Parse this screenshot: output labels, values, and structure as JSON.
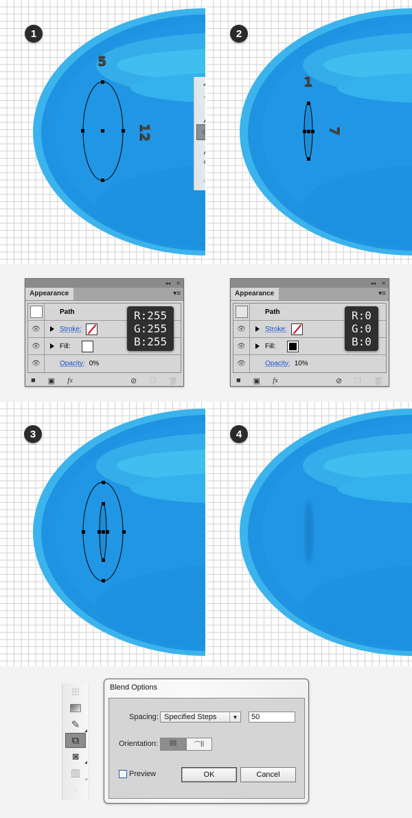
{
  "steps": [
    {
      "number": "1",
      "width_label": "5",
      "height_label": "12"
    },
    {
      "number": "2",
      "width_label": "1",
      "height_label": "7"
    },
    {
      "number": "3"
    },
    {
      "number": "4"
    }
  ],
  "colors": {
    "shape_blue": "#1f93e2",
    "shape_light": "#3bb6ee",
    "grid_line": "#d2d2d2",
    "badge": "#2b2b2b"
  },
  "toolbox_top": {
    "tools": [
      {
        "icon": "pen-icon",
        "glyph": "✒"
      },
      {
        "icon": "type-icon",
        "glyph": "T"
      },
      {
        "icon": "line-icon",
        "glyph": "╱"
      },
      {
        "icon": "ellipse-icon",
        "glyph": "⬭",
        "active": true
      },
      {
        "icon": "paintbrush-icon",
        "glyph": "🖌"
      },
      {
        "icon": "pencil-icon",
        "glyph": "✎"
      },
      {
        "icon": "eraser-icon",
        "glyph": "⌫"
      }
    ]
  },
  "appearance_panels": [
    {
      "tab": "Appearance",
      "path_label": "Path",
      "stroke_label": "Stroke:",
      "fill_label": "Fill:",
      "opacity_label": "Opacity:",
      "opacity_value": "0%",
      "fill_color": "#ffffff",
      "rgb": {
        "r": "R:255",
        "g": "G:255",
        "b": "B:255"
      }
    },
    {
      "tab": "Appearance",
      "path_label": "Path",
      "stroke_label": "Stroke:",
      "fill_label": "Fill:",
      "opacity_label": "Opacity:",
      "opacity_value": "10%",
      "fill_color": "#000000",
      "rgb": {
        "r": "R:0",
        "g": "G:0",
        "b": "B:0"
      }
    }
  ],
  "panel_controls": {
    "collapse": "◂◂",
    "close": "✕",
    "menu": "▾≡",
    "fx": "fx"
  },
  "blend_options": {
    "title": "Blend Options",
    "spacing_label": "Spacing:",
    "spacing_value": "Specified Steps",
    "steps_value": "50",
    "orientation_label": "Orientation:",
    "preview_label": "Preview",
    "preview_checked": false,
    "ok_label": "OK",
    "cancel_label": "Cancel"
  },
  "toolbox_bottom": {
    "tools": [
      {
        "icon": "mesh-icon"
      },
      {
        "icon": "gradient-icon"
      },
      {
        "icon": "eyedropper-icon"
      },
      {
        "icon": "blend-icon",
        "active": true
      },
      {
        "icon": "symbol-sprayer-icon"
      },
      {
        "icon": "column-graph-icon"
      },
      {
        "icon": "artboard-icon"
      }
    ]
  }
}
